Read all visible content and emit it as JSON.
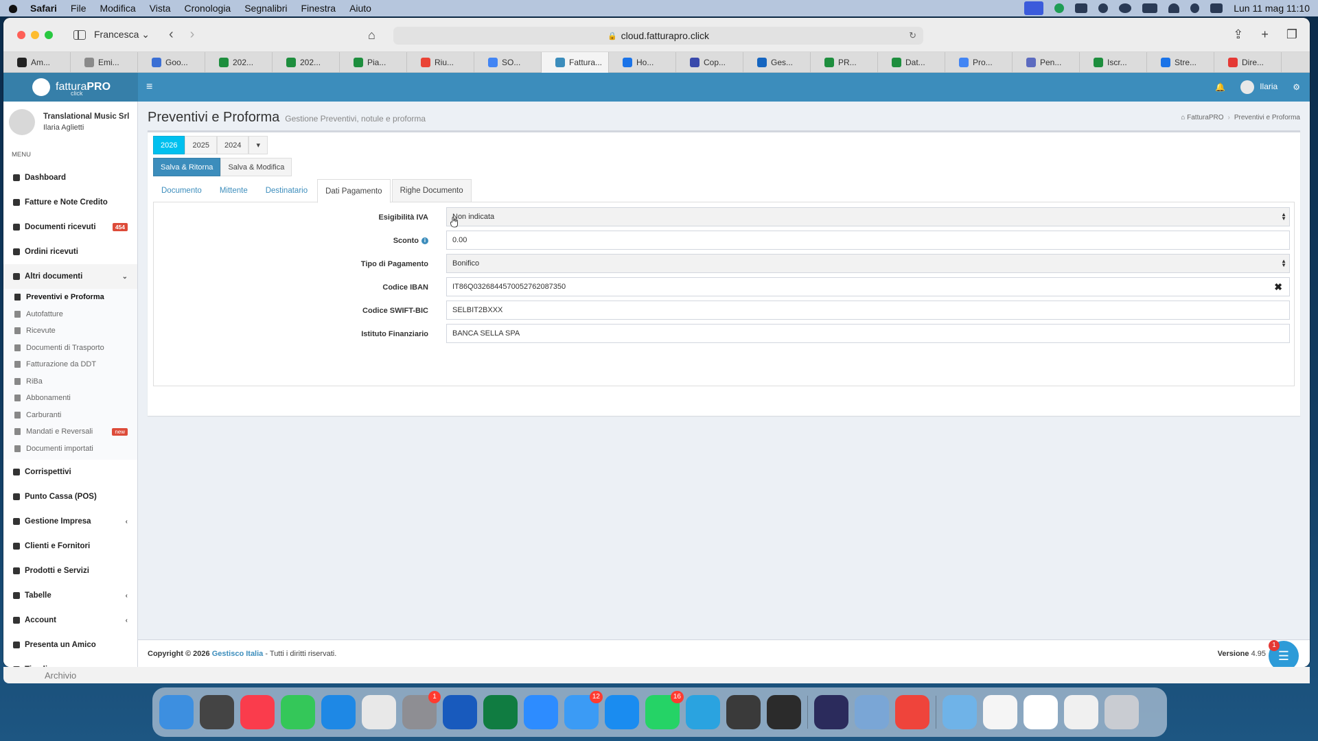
{
  "menubar": {
    "app": "Safari",
    "items": [
      "File",
      "Modifica",
      "Vista",
      "Cronologia",
      "Segnalibri",
      "Finestra",
      "Aiuto"
    ],
    "clock": "Lun 11 mag  11:10"
  },
  "browser": {
    "profile": "Francesca",
    "url": "cloud.fatturapro.click",
    "tabs": [
      {
        "label": "Am...",
        "color": "#222222"
      },
      {
        "label": "Emi...",
        "color": "#8a8a8a"
      },
      {
        "label": "Goo...",
        "color": "#3b6fd4"
      },
      {
        "label": "202...",
        "color": "#1e8e3e"
      },
      {
        "label": "202...",
        "color": "#1e8e3e"
      },
      {
        "label": "Pia...",
        "color": "#1e8e3e"
      },
      {
        "label": "Riu...",
        "color": "#ea4335"
      },
      {
        "label": "SO...",
        "color": "#4285f4"
      },
      {
        "label": "Fattura...",
        "color": "#3c8dbc"
      },
      {
        "label": "Ho...",
        "color": "#1a73e8"
      },
      {
        "label": "Cop...",
        "color": "#3949ab"
      },
      {
        "label": "Ges...",
        "color": "#1565c0"
      },
      {
        "label": "PR...",
        "color": "#1e8e3e"
      },
      {
        "label": "Dat...",
        "color": "#1e8e3e"
      },
      {
        "label": "Pro...",
        "color": "#4285f4"
      },
      {
        "label": "Pen...",
        "color": "#5c6bc0"
      },
      {
        "label": "Iscr...",
        "color": "#1e8e3e"
      },
      {
        "label": "Stre...",
        "color": "#1a73e8"
      },
      {
        "label": "Dire...",
        "color": "#e53935"
      }
    ],
    "active_tab": 8
  },
  "app": {
    "logo": {
      "brand": "fattura",
      "pro": "PRO",
      "sub": "click"
    },
    "user_name": "Ilaria",
    "company": "Translational Music Srl",
    "user_full": "Ilaria Aglietti",
    "menu_heading": "MENU",
    "sidebar_top": [
      {
        "label": "Dashboard"
      },
      {
        "label": "Fatture e Note Credito"
      },
      {
        "label": "Documenti ricevuti",
        "badge": "454"
      },
      {
        "label": "Ordini ricevuti"
      },
      {
        "label": "Altri documenti"
      }
    ],
    "submenu": [
      {
        "label": "Preventivi e Proforma",
        "current": true
      },
      {
        "label": "Autofatture"
      },
      {
        "label": "Ricevute"
      },
      {
        "label": "Documenti di Trasporto"
      },
      {
        "label": "Fatturazione da DDT"
      },
      {
        "label": "RiBa"
      },
      {
        "label": "Abbonamenti"
      },
      {
        "label": "Carburanti"
      },
      {
        "label": "Mandati e Reversali",
        "badge": "new"
      },
      {
        "label": "Documenti importati"
      }
    ],
    "sidebar_bottom": [
      {
        "label": "Corrispettivi"
      },
      {
        "label": "Punto Cassa (POS)"
      },
      {
        "label": "Gestione Impresa",
        "chev": "‹"
      },
      {
        "label": "Clienti e Fornitori"
      },
      {
        "label": "Prodotti e Servizi"
      },
      {
        "label": "Tabelle",
        "chev": "‹"
      },
      {
        "label": "Account",
        "chev": "‹"
      },
      {
        "label": "Presenta un Amico"
      },
      {
        "label": "Timeline"
      }
    ]
  },
  "page": {
    "title": "Preventivi e Proforma",
    "subtitle": "Gestione Preventivi, notule e proforma",
    "breadcrumb": [
      "FatturaPRO",
      "Preventivi e Proforma"
    ],
    "years": [
      "2026",
      "2025",
      "2024"
    ],
    "actions": {
      "save_return": "Salva & Ritorna",
      "save_edit": "Salva & Modifica"
    },
    "tabs": [
      "Documento",
      "Mittente",
      "Destinatario",
      "Dati Pagamento",
      "Righe Documento"
    ],
    "active_tab": 3,
    "form": {
      "esigibilita_label": "Esigibilità IVA",
      "esigibilita_value": "Non indicata",
      "sconto_label": "Sconto",
      "sconto_value": "0.00",
      "tipo_label": "Tipo di Pagamento",
      "tipo_value": "Bonifico",
      "iban_label": "Codice IBAN",
      "iban_value": "IT86Q0326844570052762087350",
      "swift_label": "Codice SWIFT-BIC",
      "swift_value": "SELBIT2BXXX",
      "istituto_label": "Istituto Finanziario",
      "istituto_value": "BANCA SELLA SPA"
    }
  },
  "footer": {
    "copyright": "Copyright © 2026",
    "company": "Gestisco Italia",
    "rights": "- Tutti i diritti riservati.",
    "version_label": "Versione",
    "version": "4.95"
  },
  "chat_badge": "1",
  "behind_window": "Archivio",
  "dock": [
    {
      "name": "finder",
      "color": "#3d8fe0"
    },
    {
      "name": "keychain",
      "color": "#444444"
    },
    {
      "name": "music",
      "color": "#fa3c4c"
    },
    {
      "name": "messages",
      "color": "#34c759"
    },
    {
      "name": "safari",
      "color": "#1e88e5"
    },
    {
      "name": "chrome",
      "color": "#e8e8e8"
    },
    {
      "name": "settings",
      "color": "#8e8e93",
      "badge": "1"
    },
    {
      "name": "word",
      "color": "#185abd"
    },
    {
      "name": "excel",
      "color": "#107c41"
    },
    {
      "name": "zoom",
      "color": "#2d8cff"
    },
    {
      "name": "mail",
      "color": "#3b9bf5",
      "badge": "12"
    },
    {
      "name": "app-store",
      "color": "#1a8cf0"
    },
    {
      "name": "whatsapp",
      "color": "#25d366",
      "badge": "16"
    },
    {
      "name": "telegram",
      "color": "#2aa3e0"
    },
    {
      "name": "printer",
      "color": "#3a3a3a"
    },
    {
      "name": "photo-booth",
      "color": "#2b2b2b"
    },
    {
      "name": "grammarly",
      "color": "#2b2b5c"
    },
    {
      "name": "preview",
      "color": "#7aa6d6"
    },
    {
      "name": "anydesk",
      "color": "#ef443b"
    },
    {
      "name": "downloads-folder",
      "color": "#6fb3e8"
    },
    {
      "name": "window-1",
      "color": "#f5f5f5"
    },
    {
      "name": "window-2",
      "color": "#ffffff"
    },
    {
      "name": "window-3",
      "color": "#f0f0f0"
    },
    {
      "name": "trash",
      "color": "#c9ccd2"
    }
  ]
}
